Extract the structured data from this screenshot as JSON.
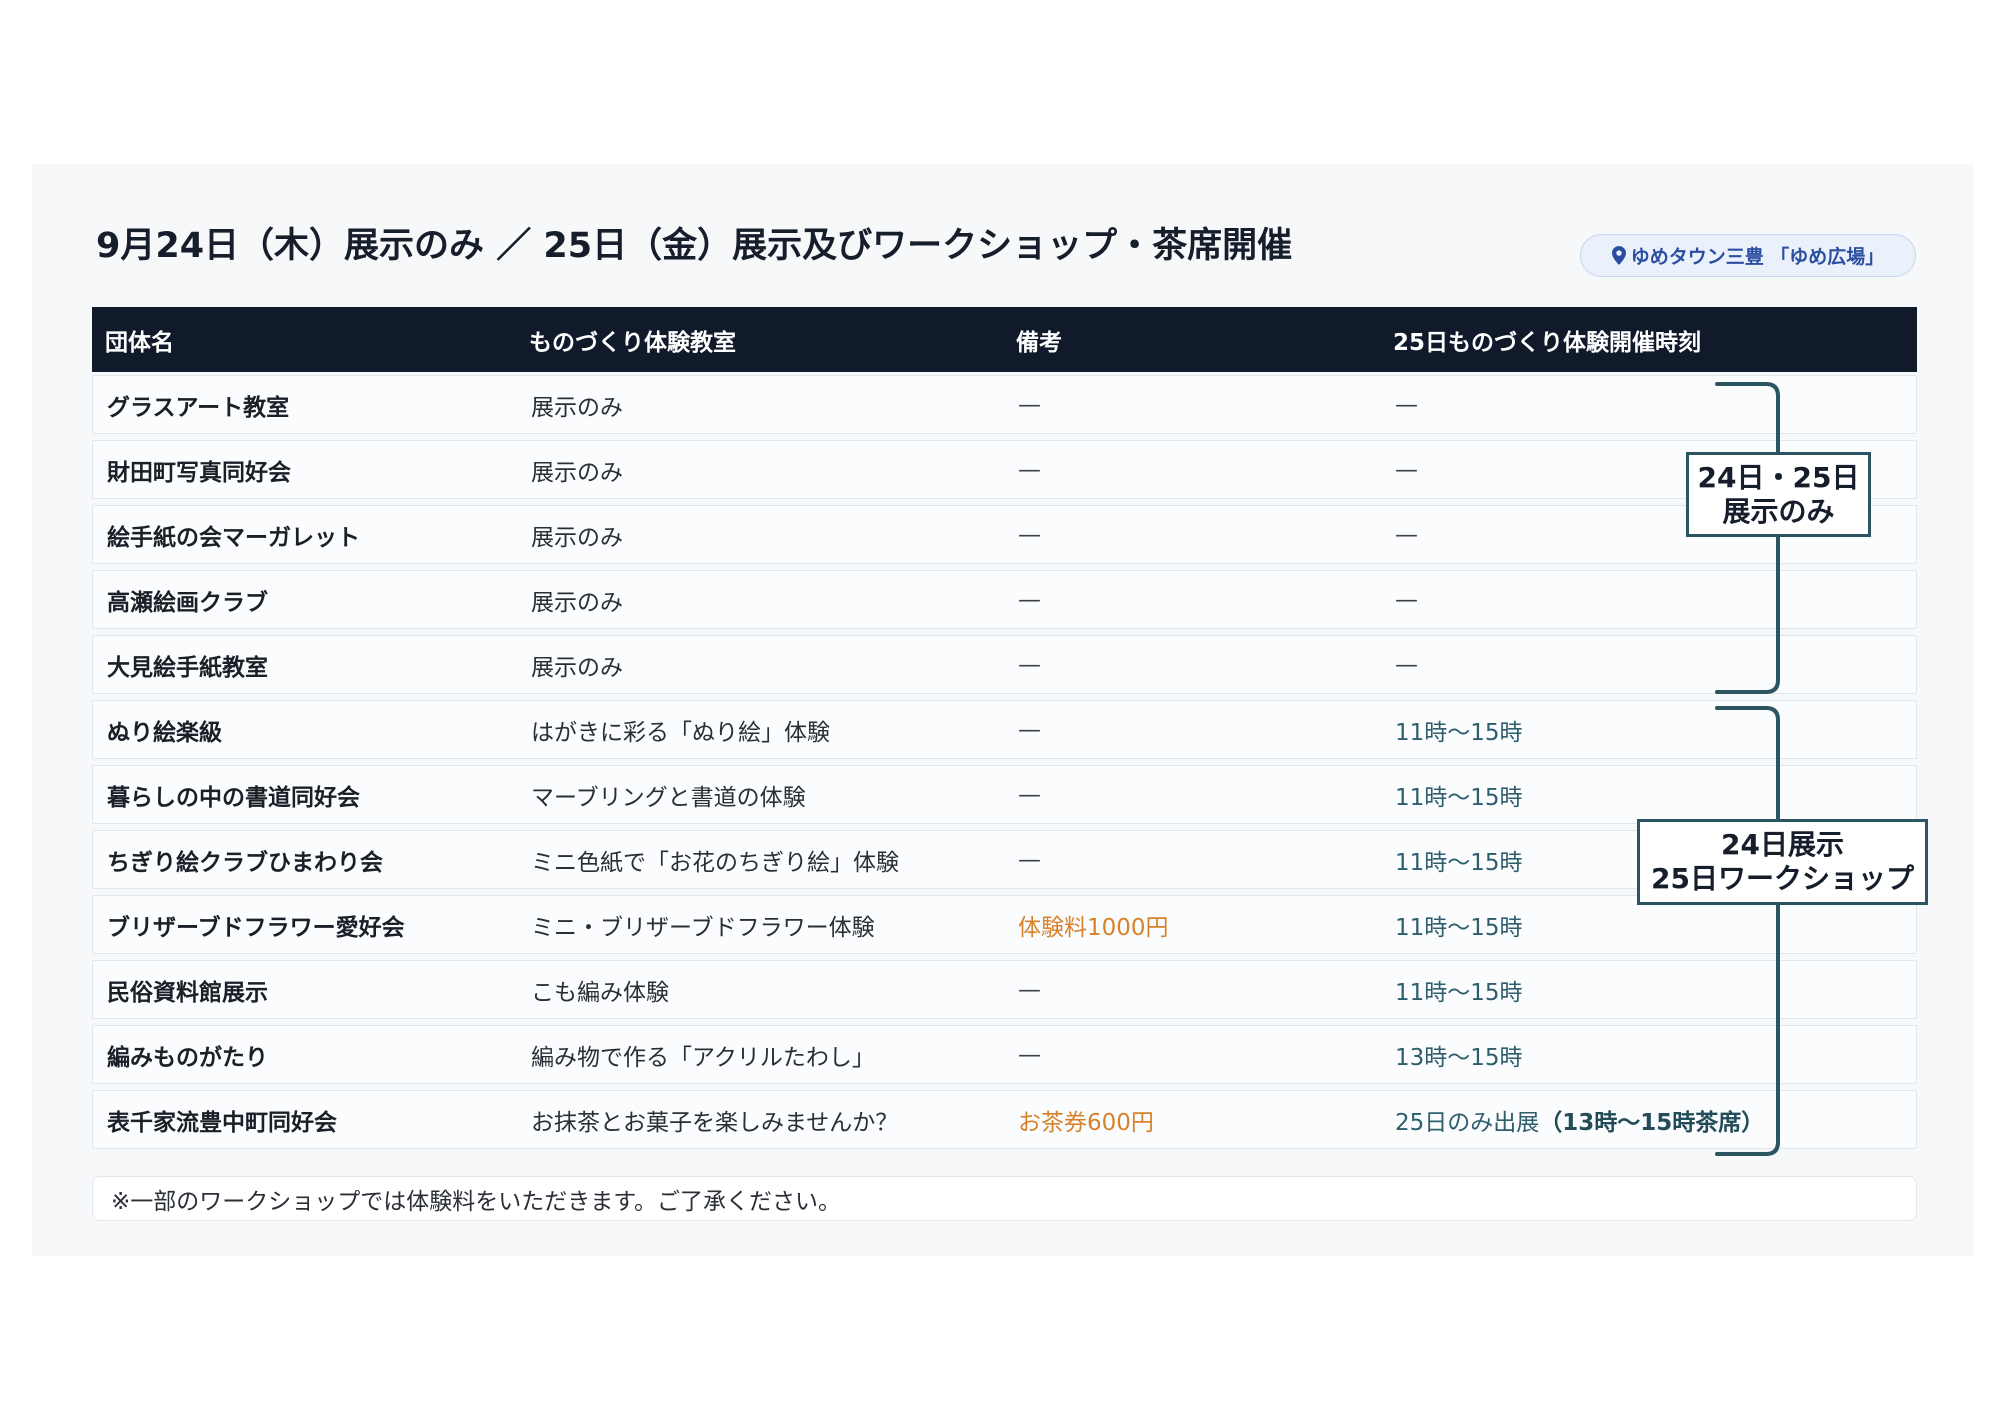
{
  "title": "9月24日（木）展示のみ ／ 25日（金）展示及びワークショップ・茶席開催",
  "location": {
    "icon": "map-pin-icon",
    "label": "ゆめタウン三豊 「ゆめ広場」"
  },
  "table": {
    "headers": [
      "団体名",
      "ものづくり体験教室",
      "備考",
      "25日ものづくり体験開催時刻"
    ],
    "rows": [
      {
        "group": "グラスアート教室",
        "workshop": "展示のみ",
        "note": "—",
        "time": "—"
      },
      {
        "group": "財田町写真同好会",
        "workshop": "展示のみ",
        "note": "—",
        "time": "—"
      },
      {
        "group": "絵手紙の会マーガレット",
        "workshop": "展示のみ",
        "note": "—",
        "time": "—"
      },
      {
        "group": "高瀬絵画クラブ",
        "workshop": "展示のみ",
        "note": "—",
        "time": "—"
      },
      {
        "group": "大見絵手紙教室",
        "workshop": "展示のみ",
        "note": "—",
        "time": "—"
      },
      {
        "group": "ぬり絵楽級",
        "workshop": "はがきに彩る「ぬり絵」体験",
        "note": "—",
        "time": "11時〜15時"
      },
      {
        "group": "暮らしの中の書道同好会",
        "workshop": "マーブリングと書道の体験",
        "note": "—",
        "time": "11時〜15時"
      },
      {
        "group": "ちぎり絵クラブひまわり会",
        "workshop": "ミニ色紙で「お花のちぎり絵」体験",
        "note": "—",
        "time": "11時〜15時"
      },
      {
        "group": "ブリザーブドフラワー愛好会",
        "workshop": "ミニ・ブリザーブドフラワー体験",
        "note": "体験料1000円",
        "time": "11時〜15時"
      },
      {
        "group": "民俗資料館展示",
        "workshop": "こも編み体験",
        "note": "—",
        "time": "11時〜15時"
      },
      {
        "group": "編みものがたり",
        "workshop": "編み物で作る「アクリルたわし」",
        "note": "—",
        "time": "13時〜15時"
      },
      {
        "group": "表千家流豊中町同好会",
        "workshop": "お抹茶とお菓子を楽しみませんか？",
        "note": "お茶券600円",
        "time": "25日のみ出展",
        "time_bold": "（13時〜15時茶席）"
      }
    ]
  },
  "annotations": [
    {
      "line1": "24日・25日",
      "line2": "展示のみ"
    },
    {
      "line1": "24日展示",
      "line2": "25日ワークショップ"
    }
  ],
  "footnote": "※一部のワークショップでは体験料をいただきます。ご了承ください。",
  "colors": {
    "header_bg": "#111a2a",
    "bracket_teal": "#2b5560",
    "fee_orange": "#d8812b",
    "time_teal": "#2e5d6c",
    "location_blue": "#2b4ea0"
  }
}
